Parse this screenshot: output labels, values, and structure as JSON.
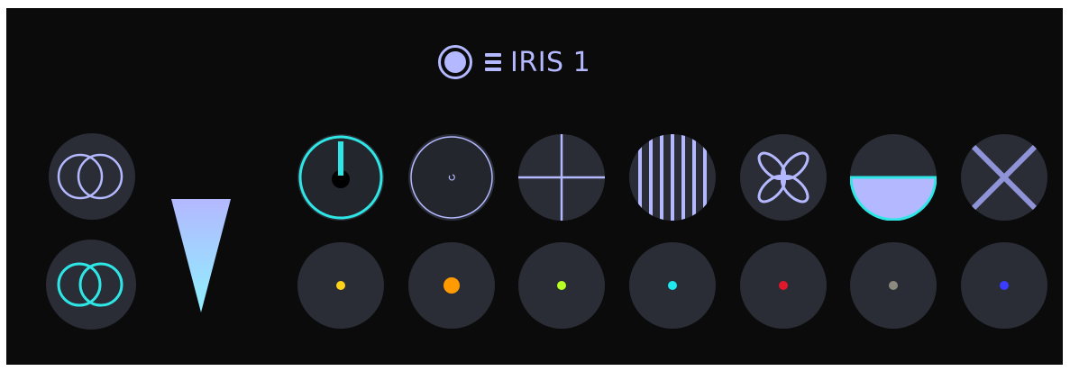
{
  "header": {
    "title": "IRIS 1",
    "icons": [
      "iris-ring-icon",
      "menu-icon"
    ]
  },
  "side_controls": [
    {
      "name": "overlap-rings-lavender",
      "color": "#b4b8ff"
    },
    {
      "name": "overlap-rings-cyan",
      "color": "#2ee6e6"
    }
  ],
  "intensity_wedge": {
    "icon": "wedge-icon",
    "color": "#b4e6ff"
  },
  "gobo_row": [
    {
      "name": "iris-dial",
      "accent": "#2ee6e6"
    },
    {
      "name": "open-circle",
      "accent": "#b4b8ff"
    },
    {
      "name": "crosshair",
      "accent": "#b4b8ff"
    },
    {
      "name": "vertical-lines",
      "accent": "#b4b8ff"
    },
    {
      "name": "flower",
      "accent": "#b4b8ff"
    },
    {
      "name": "half-moon",
      "accent": "#b4b8ff"
    },
    {
      "name": "x-cross",
      "accent": "#b4b8ff"
    }
  ],
  "color_row": [
    {
      "name": "yellow",
      "hex": "#ffd21a"
    },
    {
      "name": "orange",
      "hex": "#ff9a00"
    },
    {
      "name": "lime",
      "hex": "#b8ff24"
    },
    {
      "name": "cyan",
      "hex": "#1fe8f0"
    },
    {
      "name": "red",
      "hex": "#e0182c"
    },
    {
      "name": "gray",
      "hex": "#8c8a7e"
    },
    {
      "name": "blue",
      "hex": "#3a3cff"
    }
  ]
}
